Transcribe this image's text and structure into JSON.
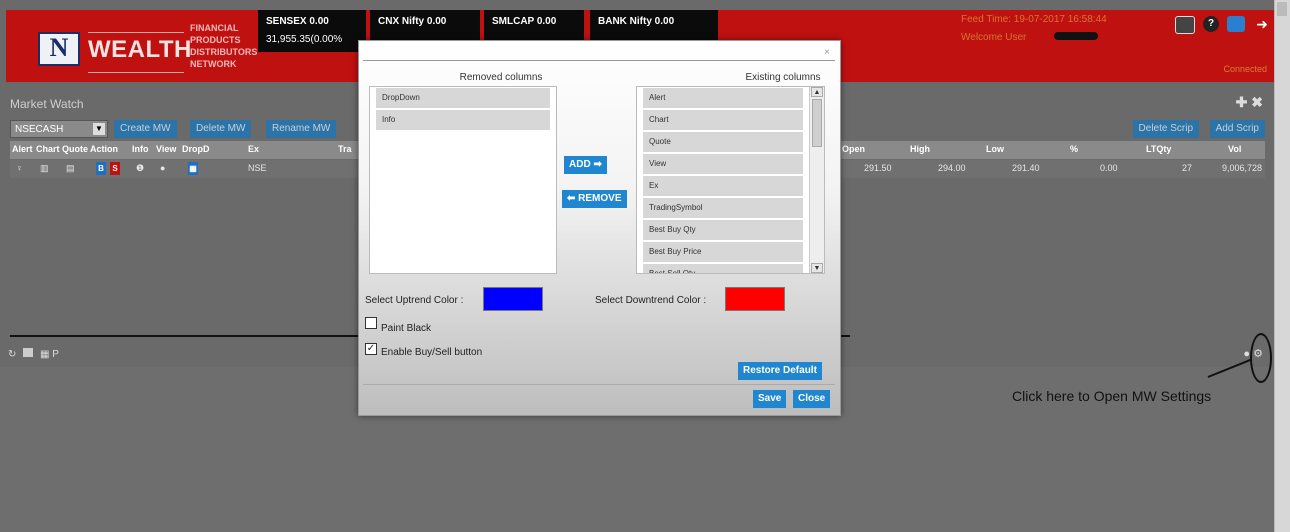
{
  "header": {
    "logo_mark": "N",
    "logo_text": "WEALTH",
    "logo_subtitle": "FINANCIAL PRODUCTS DISTRIBUTORS NETWORK",
    "tickers": [
      {
        "name": "SENSEX  0.00",
        "sub": "31,955.35(0.00%"
      },
      {
        "name": "CNX Nifty  0.00",
        "sub": ""
      },
      {
        "name": "SMLCAP  0.00",
        "sub": ""
      },
      {
        "name": "BANK Nifty  0.00",
        "sub": ""
      }
    ],
    "feed_time": "Feed Time: 19-07-2017 16:58:44",
    "welcome": "Welcome User",
    "connection_status": "Connected",
    "icons": [
      "keyboard-icon",
      "help-icon",
      "user-icon",
      "logout-icon"
    ]
  },
  "market_watch": {
    "title": "Market Watch",
    "selected_segment": "NSECASH",
    "buttons": {
      "create": "Create MW",
      "delete": "Delete MW",
      "rename": "Rename MW",
      "delete_scrip": "Delete Scrip",
      "add_scrip": "Add Scrip"
    },
    "columns_left": [
      "Alert",
      "Chart",
      "Quote",
      "Action",
      "Info",
      "View",
      "DropD",
      "Ex",
      "Tra"
    ],
    "columns_right": [
      "Open",
      "High",
      "Low",
      "%",
      "LTQty",
      "Vol"
    ],
    "row": {
      "buy": "B",
      "sell": "S",
      "ex": "NSE",
      "open": "291.50",
      "high": "294.00",
      "low": "291.40",
      "pct": "0.00",
      "ltqty": "27",
      "vol": "9,006,728"
    },
    "footer_mark": "P"
  },
  "annotation": "Click here to Open MW Settings",
  "dialog": {
    "close_symbol": "×",
    "removed_title": "Removed columns",
    "existing_title": "Existing columns",
    "removed_columns": [
      "DropDown",
      "Info"
    ],
    "existing_columns": [
      "Alert",
      "Chart",
      "Quote",
      "View",
      "Ex",
      "TradingSymbol",
      "Best Buy Qty",
      "Best Buy Price",
      "Best Sell Qty"
    ],
    "add_label": "ADD ➡",
    "remove_label": "⬅ REMOVE",
    "uptrend_label": "Select Uptrend Color :",
    "uptrend_color": "#0000ff",
    "downtrend_label": "Select Downtrend Color :",
    "downtrend_color": "#ff0000",
    "paint_black_label": "Paint Black",
    "paint_black_checked": false,
    "enable_buysell_label": "Enable Buy/Sell button",
    "enable_buysell_checked": true,
    "restore_label": "Restore Default",
    "save_label": "Save",
    "close_label": "Close"
  },
  "colors": {
    "header_red": "#c01111",
    "button_blue": "#1f86cf",
    "grid_gray": "#6a6a6a"
  }
}
